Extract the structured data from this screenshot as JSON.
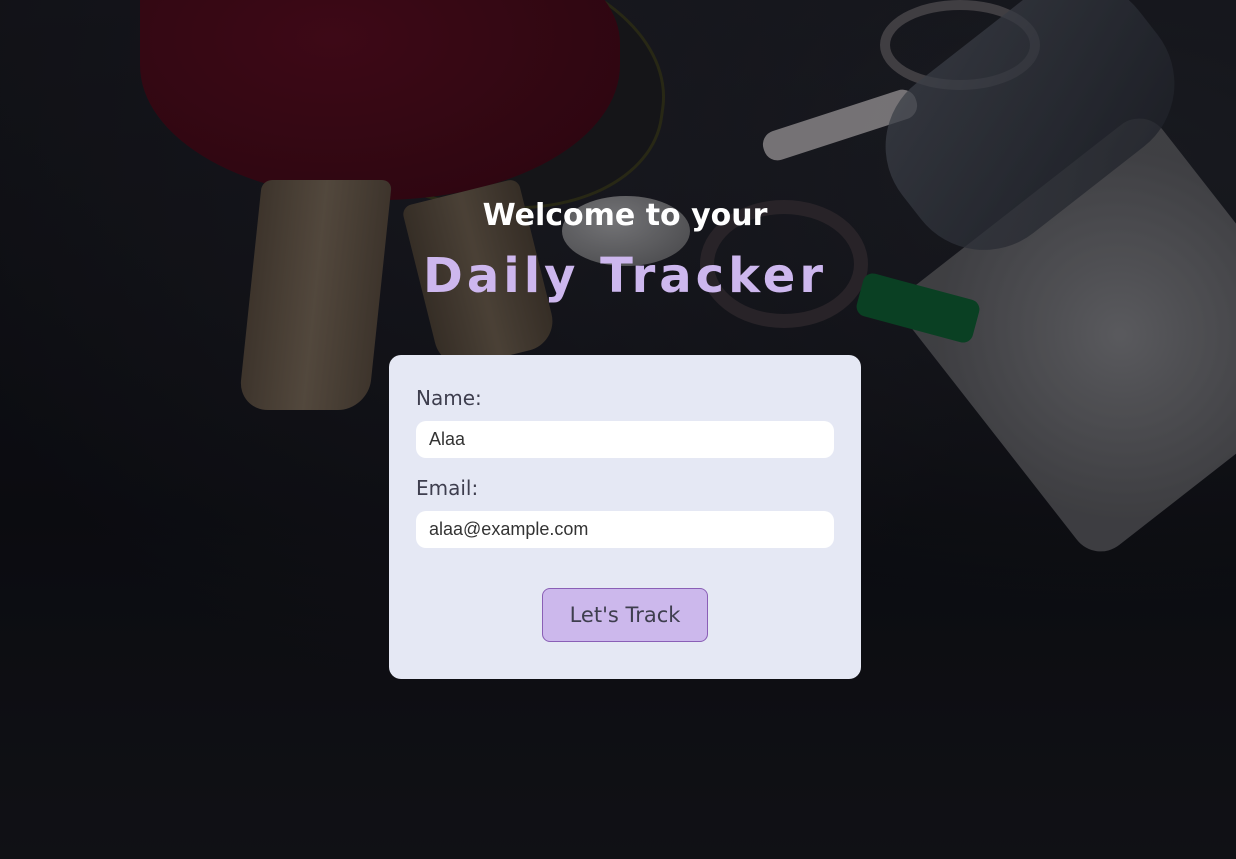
{
  "hero": {
    "welcome": "Welcome to your",
    "brand": "Daily Tracker"
  },
  "form": {
    "name_label": "Name:",
    "name_value": "Alaa",
    "email_label": "Email:",
    "email_value": "alaa@example.com",
    "submit_label": "Let's Track"
  },
  "colors": {
    "brand_accent": "#cdb7ee",
    "card_background": "#e5e8f4",
    "button_background": "#ccb8ec",
    "button_border": "#8a5fb6"
  }
}
